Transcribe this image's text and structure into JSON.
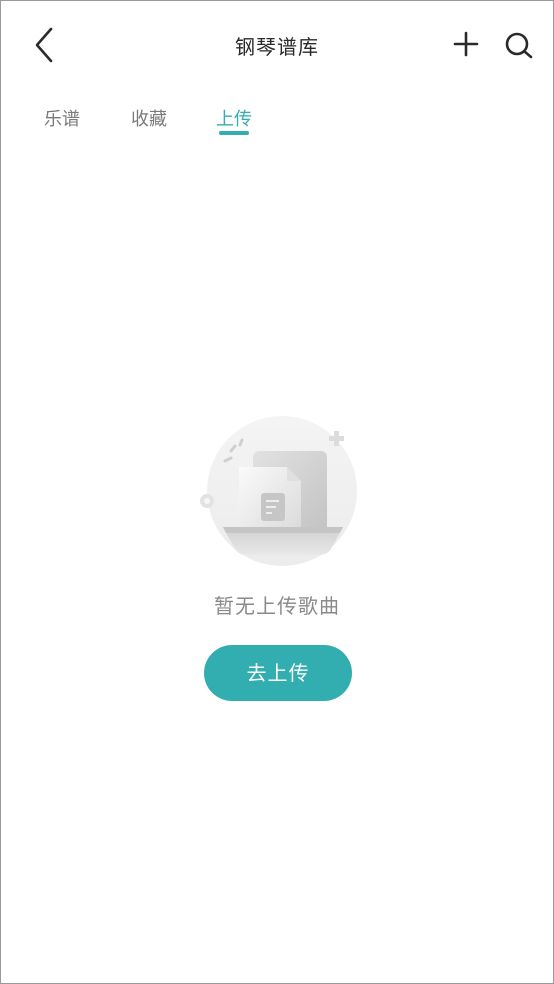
{
  "header": {
    "title": "钢琴谱库",
    "back_icon": "chevron-left-icon",
    "add_icon": "plus-icon",
    "search_icon": "search-icon"
  },
  "tabs": [
    {
      "label": "乐谱",
      "active": false
    },
    {
      "label": "收藏",
      "active": false
    },
    {
      "label": "上传",
      "active": true
    }
  ],
  "empty_state": {
    "illustration_icon": "empty-document-icon",
    "message": "暂无上传歌曲",
    "action_label": "去上传"
  },
  "colors": {
    "accent": "#33aeb0",
    "text_primary": "#2a2a2a",
    "text_secondary": "#7a7a7a"
  }
}
